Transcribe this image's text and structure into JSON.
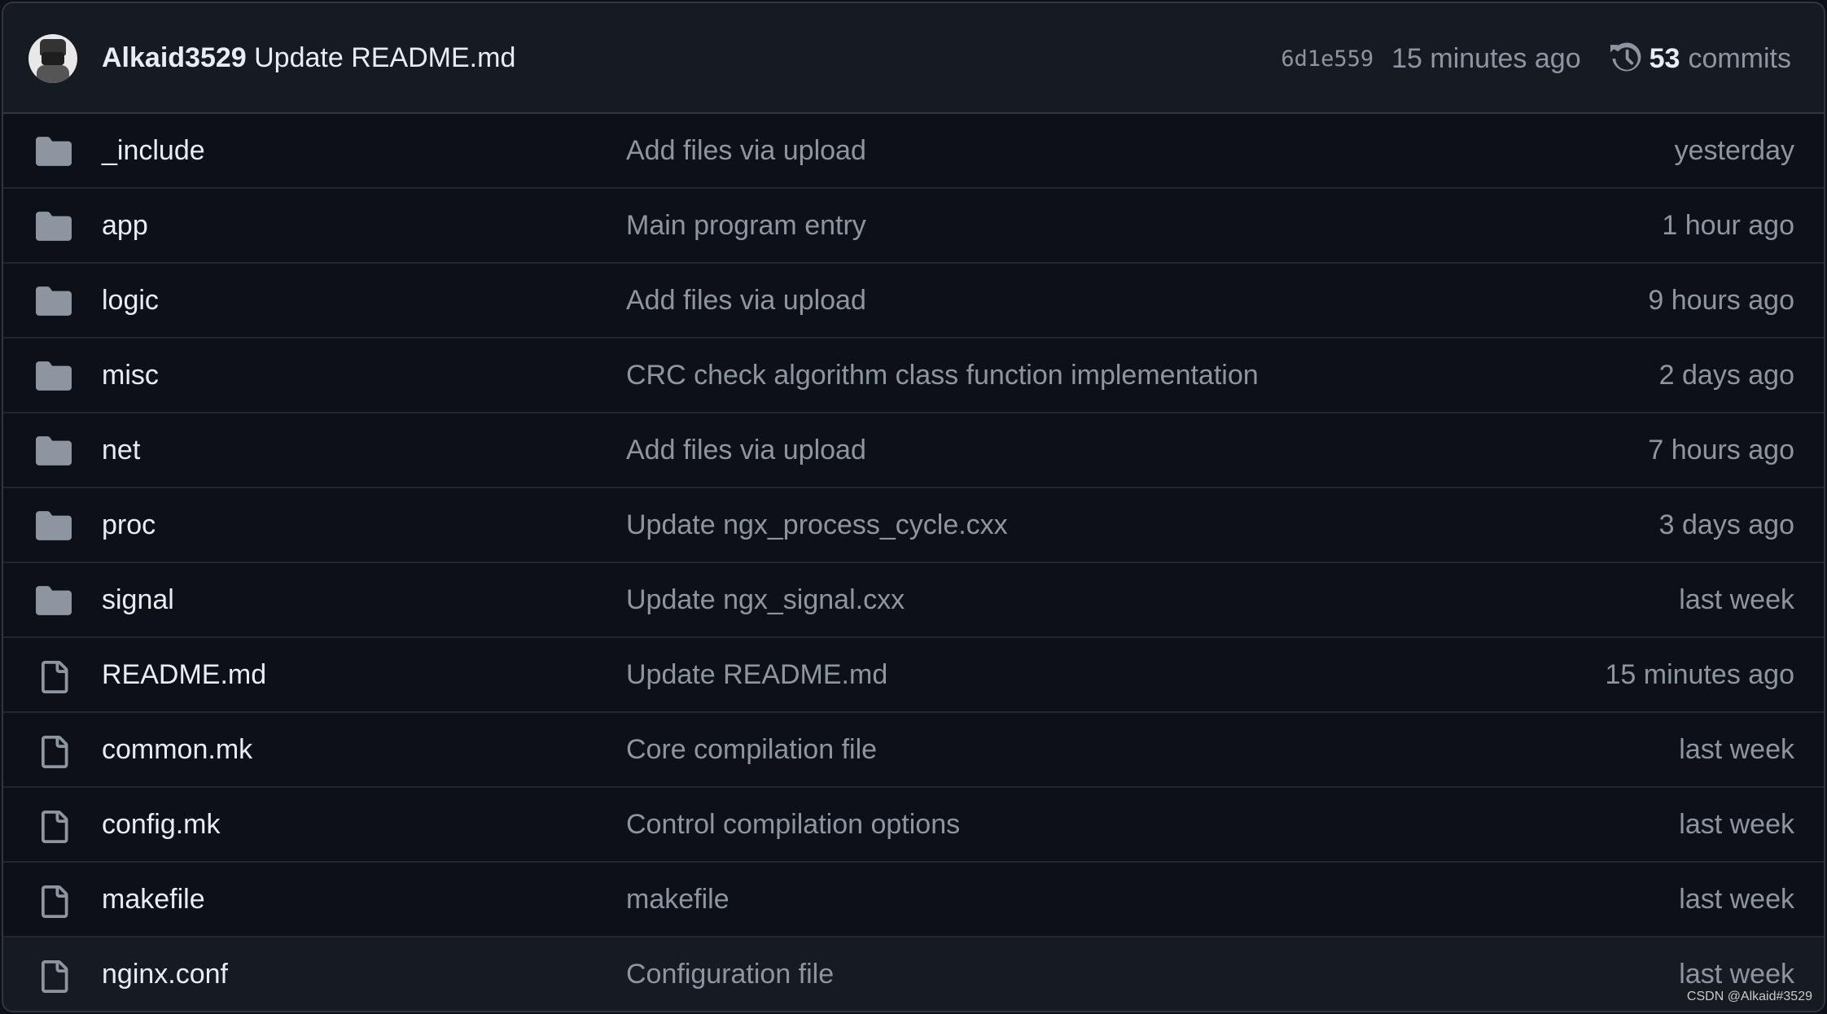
{
  "header": {
    "author": "Alkaid3529",
    "message": "Update README.md",
    "sha": "6d1e559",
    "time": "15 minutes ago",
    "commit_count": "53",
    "commits_label": "commits",
    "history_icon": "history-icon"
  },
  "files": [
    {
      "type": "folder",
      "name": "_include",
      "message": "Add files via upload",
      "date": "yesterday"
    },
    {
      "type": "folder",
      "name": "app",
      "message": "Main program entry",
      "date": "1 hour ago"
    },
    {
      "type": "folder",
      "name": "logic",
      "message": "Add files via upload",
      "date": "9 hours ago"
    },
    {
      "type": "folder",
      "name": "misc",
      "message": "CRC check algorithm class function implementation",
      "date": "2 days ago"
    },
    {
      "type": "folder",
      "name": "net",
      "message": "Add files via upload",
      "date": "7 hours ago"
    },
    {
      "type": "folder",
      "name": "proc",
      "message": "Update ngx_process_cycle.cxx",
      "date": "3 days ago"
    },
    {
      "type": "folder",
      "name": "signal",
      "message": "Update ngx_signal.cxx",
      "date": "last week"
    },
    {
      "type": "file",
      "name": "README.md",
      "message": "Update README.md",
      "date": "15 minutes ago"
    },
    {
      "type": "file",
      "name": "common.mk",
      "message": "Core compilation file",
      "date": "last week"
    },
    {
      "type": "file",
      "name": "config.mk",
      "message": "Control compilation options",
      "date": "last week"
    },
    {
      "type": "file",
      "name": "makefile",
      "message": "makefile",
      "date": "last week"
    },
    {
      "type": "file",
      "name": "nginx.conf",
      "message": "Configuration file",
      "date": "last week"
    }
  ],
  "watermark": "CSDN @Alkaid#3529",
  "colors": {
    "background": "#0d1117",
    "header": "#161b22",
    "border": "#30363d",
    "text": "#e6edf3",
    "muted": "#8d96a0"
  }
}
